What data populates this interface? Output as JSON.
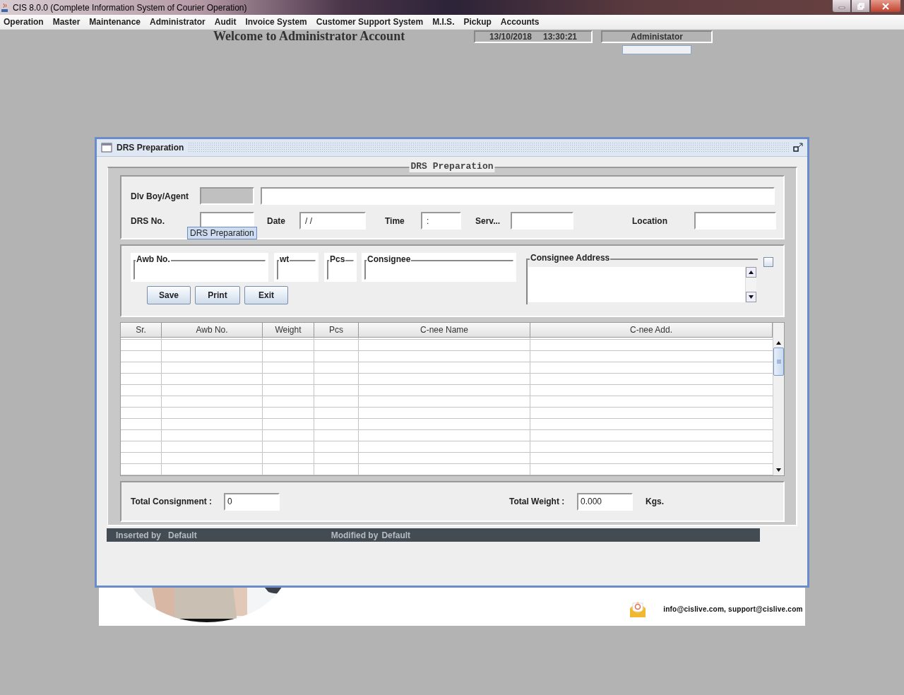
{
  "app_window": {
    "title": "CIS 8.0.0 (Complete Information System of Courier Operation)",
    "menu": [
      {
        "label": "Operation"
      },
      {
        "label": "Master"
      },
      {
        "label": "Maintenance"
      },
      {
        "label": "Administrator"
      },
      {
        "label": "Audit"
      },
      {
        "label": "Invoice System"
      },
      {
        "label": "Customer Support System"
      },
      {
        "label": "M.I.S."
      },
      {
        "label": "Pickup"
      },
      {
        "label": "Accounts"
      }
    ]
  },
  "header": {
    "welcome": "Welcome to Administrator Account",
    "date": "13/10/2018",
    "time": "13:30:21",
    "user": "Administator"
  },
  "drs_window": {
    "title": "DRS Preparation",
    "panel_title": "DRS Preparation",
    "form": {
      "dlv_boy": {
        "label": "Dlv Boy/Agent",
        "disabled": true
      },
      "drs_no": {
        "label": "DRS No."
      },
      "date": {
        "label": "Date",
        "value": "/ /"
      },
      "time": {
        "label": "Time",
        "value": ":"
      },
      "serv": {
        "label": "Serv..."
      },
      "location": {
        "label": "Location"
      }
    },
    "tooltip": "DRS Preparation",
    "entry": {
      "awb": "Awb No.",
      "wt": "wt",
      "pcs": "Pcs",
      "consignee": "Consignee",
      "address": "Consignee Address",
      "checked": false
    },
    "buttons": [
      "Save",
      "Print",
      "Exit"
    ],
    "table": {
      "columns": [
        "Sr.",
        "Awb No.",
        "Weight",
        "Pcs",
        "C-nee Name",
        "C-nee Add."
      ]
    },
    "totals": {
      "consignment_label": "Total Consignment :",
      "consignment": "0",
      "weight_label": "Total Weight :",
      "weight": "0.000",
      "unit": "Kgs."
    },
    "status": {
      "inserted_label": "Inserted by",
      "inserted": "Default",
      "modified_label": "Modified by",
      "modified": "Default"
    }
  },
  "footer": {
    "contact": "info@cislive.com, support@cislive.com"
  }
}
